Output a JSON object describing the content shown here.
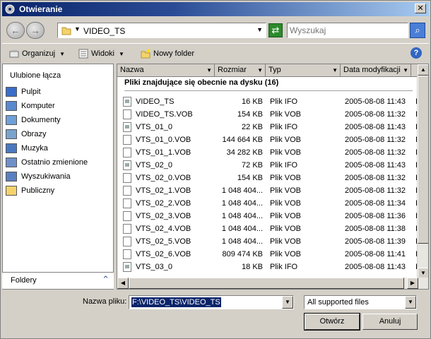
{
  "window": {
    "title": "Otwieranie",
    "close_label": "✕"
  },
  "nav": {
    "back_label": "←",
    "forward_label": "→",
    "address_path": "VIDEO_TS",
    "search_placeholder": "Wyszukaj"
  },
  "toolbar": {
    "organize_label": "Organizuj",
    "views_label": "Widoki",
    "new_folder_label": "Nowy folder",
    "help_label": "?"
  },
  "favorites": {
    "title": "Ulubione łącza",
    "items": [
      {
        "label": "Pulpit",
        "icon": "desktop-icon"
      },
      {
        "label": "Komputer",
        "icon": "computer-icon"
      },
      {
        "label": "Dokumenty",
        "icon": "documents-icon"
      },
      {
        "label": "Obrazy",
        "icon": "pictures-icon"
      },
      {
        "label": "Muzyka",
        "icon": "music-icon"
      },
      {
        "label": "Ostatnio zmienione",
        "icon": "recent-icon"
      },
      {
        "label": "Wyszukiwania",
        "icon": "searches-icon"
      },
      {
        "label": "Publiczny",
        "icon": "public-folder-icon"
      }
    ],
    "folders_label": "Foldery"
  },
  "filelist": {
    "columns": [
      "Nazwa",
      "Rozmiar",
      "Typ",
      "Data modyfikacji"
    ],
    "group_title": "Pliki znajdujące się obecnie na dysku (16)",
    "rows": [
      {
        "name": "VIDEO_TS",
        "size": "16 KB",
        "type": "Plik IFO",
        "date": "2005-08-08 11:43",
        "extra": "I",
        "icon": "info"
      },
      {
        "name": "VIDEO_TS.VOB",
        "size": "154 KB",
        "type": "Plik VOB",
        "date": "2005-08-08 11:32",
        "extra": "I",
        "icon": "file"
      },
      {
        "name": "VTS_01_0",
        "size": "22 KB",
        "type": "Plik IFO",
        "date": "2005-08-08 11:43",
        "extra": "I",
        "icon": "info"
      },
      {
        "name": "VTS_01_0.VOB",
        "size": "144 664 KB",
        "type": "Plik VOB",
        "date": "2005-08-08 11:32",
        "extra": "I",
        "icon": "file"
      },
      {
        "name": "VTS_01_1.VOB",
        "size": "34 282 KB",
        "type": "Plik VOB",
        "date": "2005-08-08 11:32",
        "extra": "I",
        "icon": "file"
      },
      {
        "name": "VTS_02_0",
        "size": "72 KB",
        "type": "Plik IFO",
        "date": "2005-08-08 11:43",
        "extra": "I",
        "icon": "info"
      },
      {
        "name": "VTS_02_0.VOB",
        "size": "154 KB",
        "type": "Plik VOB",
        "date": "2005-08-08 11:32",
        "extra": "I",
        "icon": "file"
      },
      {
        "name": "VTS_02_1.VOB",
        "size": "1 048 404...",
        "type": "Plik VOB",
        "date": "2005-08-08 11:32",
        "extra": "I",
        "icon": "file"
      },
      {
        "name": "VTS_02_2.VOB",
        "size": "1 048 404...",
        "type": "Plik VOB",
        "date": "2005-08-08 11:34",
        "extra": "I",
        "icon": "file"
      },
      {
        "name": "VTS_02_3.VOB",
        "size": "1 048 404...",
        "type": "Plik VOB",
        "date": "2005-08-08 11:36",
        "extra": "I",
        "icon": "file"
      },
      {
        "name": "VTS_02_4.VOB",
        "size": "1 048 404...",
        "type": "Plik VOB",
        "date": "2005-08-08 11:38",
        "extra": "I",
        "icon": "file"
      },
      {
        "name": "VTS_02_5.VOB",
        "size": "1 048 404...",
        "type": "Plik VOB",
        "date": "2005-08-08 11:39",
        "extra": "I",
        "icon": "file"
      },
      {
        "name": "VTS_02_6.VOB",
        "size": "809 474 KB",
        "type": "Plik VOB",
        "date": "2005-08-08 11:41",
        "extra": "I",
        "icon": "file"
      },
      {
        "name": "VTS_03_0",
        "size": "18 KB",
        "type": "Plik IFO",
        "date": "2005-08-08 11:43",
        "extra": "I",
        "icon": "info"
      }
    ]
  },
  "footer": {
    "filename_label": "Nazwa pliku:",
    "filename_value": "F:\\VIDEO_TS\\VIDEO_TS",
    "filter_value": "All supported files",
    "open_label": "Otwórz",
    "cancel_label": "Anuluj"
  }
}
